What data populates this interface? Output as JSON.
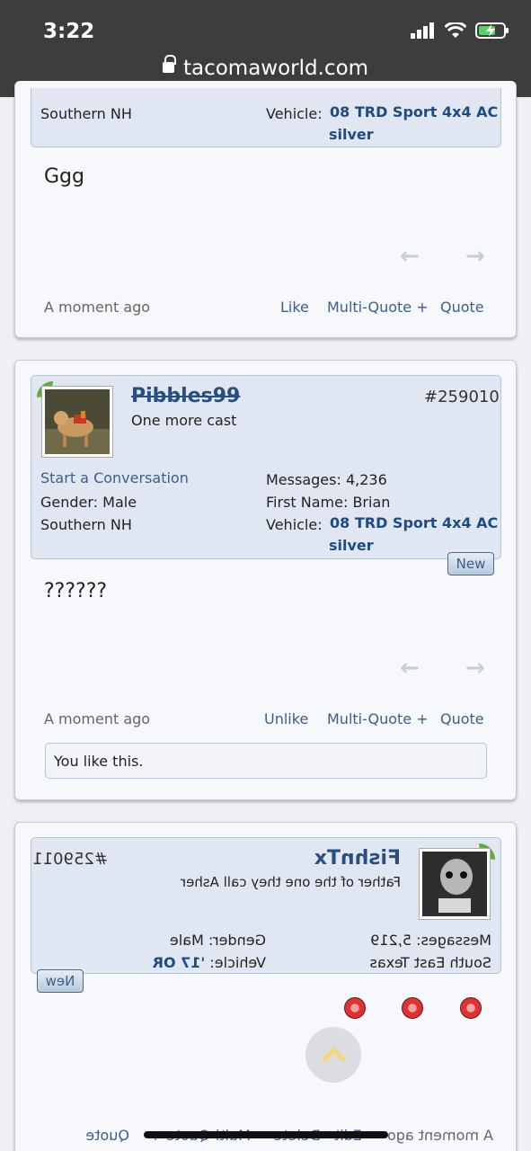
{
  "status_bar": {
    "time": "3:22",
    "url": "tacomaworld.com"
  },
  "post1": {
    "location": "Southern NH",
    "vehicle_label": "Vehicle:",
    "vehicle_line1": "08 TRD Sport 4x4 AC",
    "vehicle_line2": "silver",
    "message": "Ggg",
    "time": "A moment ago",
    "like": "Like",
    "multiquote": "Multi-Quote +",
    "quote": "Quote"
  },
  "post2": {
    "username": "Pibbles99",
    "user_title": "One more cast",
    "post_number": "#259010",
    "start_conversation": "Start a Conversation",
    "gender_label": "Gender:",
    "gender_value": "Male",
    "location": "Southern NH",
    "messages_label": "Messages:",
    "messages_value": "4,236",
    "firstname_label": "First Name:",
    "firstname_value": "Brian",
    "vehicle_label": "Vehicle:",
    "vehicle_line1": "08 TRD Sport 4x4 AC",
    "vehicle_line2": "silver",
    "new_badge": "New",
    "message": "??????",
    "time": "A moment ago",
    "unlike": "Unlike",
    "multiquote": "Multi-Quote +",
    "quote": "Quote",
    "like_notice": "You like this."
  },
  "post3": {
    "username": "FishnTx",
    "user_title": "Father of the one they call Asher",
    "post_number": "#259011",
    "messages_label": "Messages:",
    "messages_value": "5,219",
    "location": "South East Texas",
    "gender_label": "Gender:",
    "gender_value": "Male",
    "vehicle_label": "Vehicle:",
    "vehicle_value": "'17 OR",
    "new_badge": "New",
    "time": "A moment ago",
    "edit": "Edit",
    "delete": "Delete",
    "multiquote": "Multi-Quote +",
    "quote": "Quote"
  }
}
